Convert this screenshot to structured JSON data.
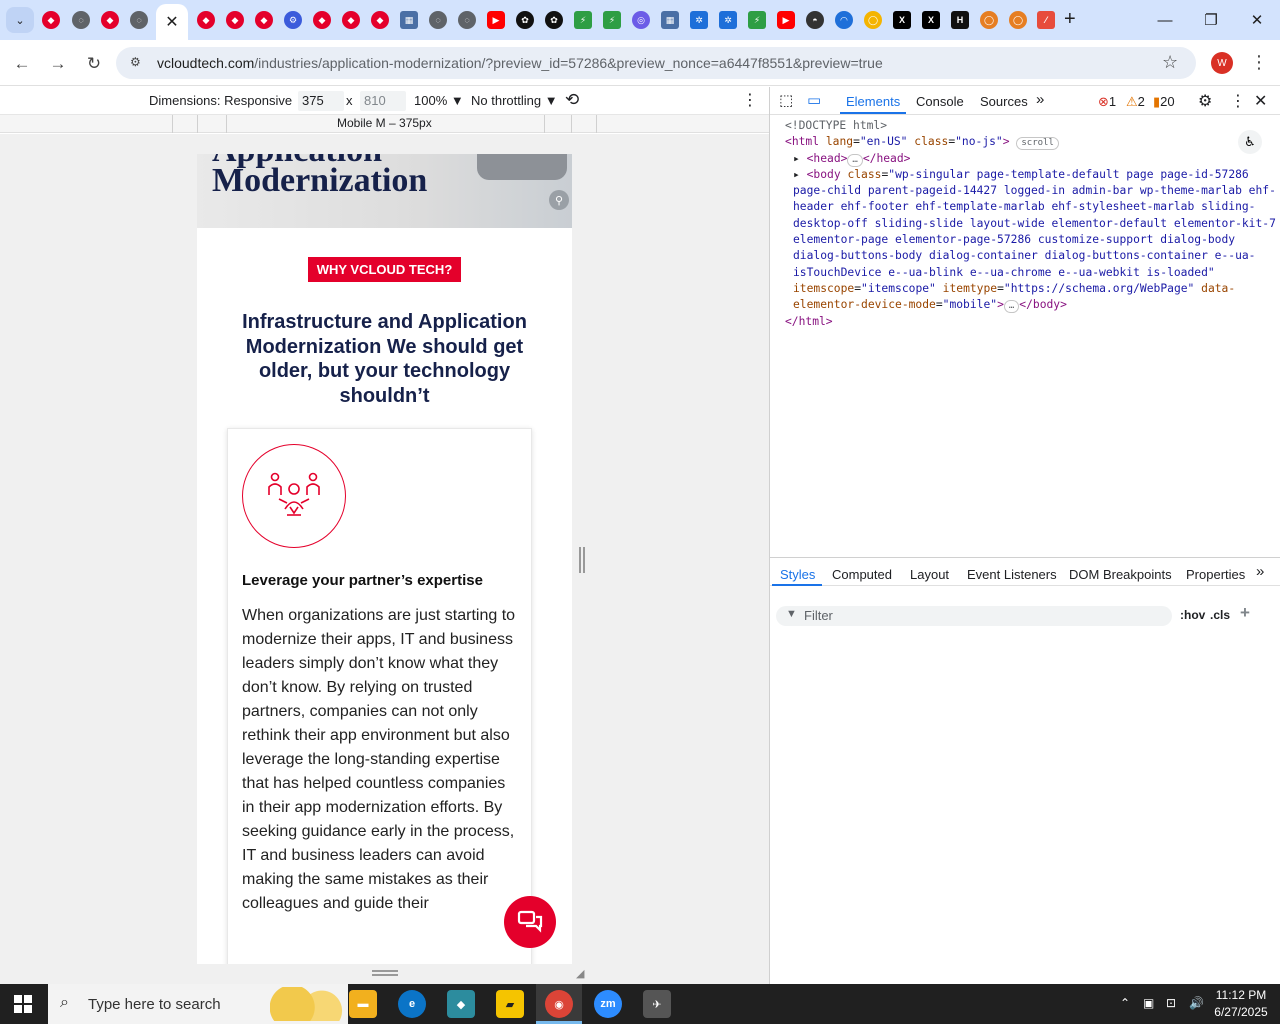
{
  "browser": {
    "url_host": "vcloudtech.com",
    "url_path": "/industries/application-modernization/?preview_id=57286&preview_nonce=a6447f8551&preview=true",
    "profile_initial": "W",
    "tab_close": "✕",
    "new_tab": "+"
  },
  "device_toolbar": {
    "dimensions_label": "Dimensions: Responsive ▼",
    "width": "375",
    "x_sep": "x",
    "height": "810",
    "zoom": "100% ▼",
    "throttle": "No throttling ▼",
    "preset_label": "Mobile M – 375px"
  },
  "page": {
    "hero_title": "Modernization",
    "hero_title_top": "Application",
    "badge": "WHY VCLOUD TECH?",
    "headline": "Infrastructure and Application Modernization We should get older, but your technology shouldn’t",
    "card_title": "Leverage your partner’s expertise",
    "card_body": "When organizations are just starting to modernize their apps, IT and business leaders simply don’t know what they don’t know. By relying on trusted partners, companies can not only rethink their app environment but also leverage the long-standing expertise that has helped countless companies in their app modernization efforts. By seeking guidance early in the process, IT and business leaders can avoid making the same mistakes as their colleagues and guide their"
  },
  "devtools": {
    "tabs": [
      "Elements",
      "Console",
      "Sources",
      "»"
    ],
    "errors": "1",
    "warnings": "2",
    "issues": "20",
    "code": {
      "doctype": "<!DOCTYPE html>",
      "html_tag": "html",
      "html_attr1": "lang",
      "html_val1": "\"en-US\"",
      "html_attr2": "class",
      "html_val2": "\"no-js\"",
      "scroll_pill": "scroll",
      "head": "<head>",
      "head_close": "</head>",
      "ellipsis": "…",
      "body_class": "\"wp-singular page-template-default page page-id-57286 page-child parent-pageid-14427 logged-in admin-bar wp-theme-marlab ehf-header ehf-footer ehf-template-marlab ehf-stylesheet-marlab sliding-desktop-off sliding-slide layout-wide elementor-default elementor-kit-7 elementor-page elementor-page-57286 customize-support dialog-body dialog-buttons-body dialog-container dialog-buttons-container e--ua-isTouchDevice e--ua-blink e--ua-chrome e--ua-webkit is-loaded\"",
      "body_itemscope": "\"itemscope\"",
      "body_itemtype": "\"https://schema.org/WebPage\"",
      "body_mode": "\"mobile\"",
      "body_close": "</body>",
      "html_close": "</html>"
    },
    "styles_tabs": [
      "Styles",
      "Computed",
      "Layout",
      "Event Listeners",
      "DOM Breakpoints",
      "Properties",
      "»"
    ],
    "filter_placeholder": "Filter",
    "hov": ":hov",
    "cls": ".cls"
  },
  "taskbar": {
    "search_placeholder": "Type here to search",
    "time": "11:12 PM",
    "date": "6/27/2025"
  },
  "colors": {
    "brand_red": "#e4002b",
    "brand_navy": "#16214a",
    "devtools_blue": "#1a73e8"
  }
}
